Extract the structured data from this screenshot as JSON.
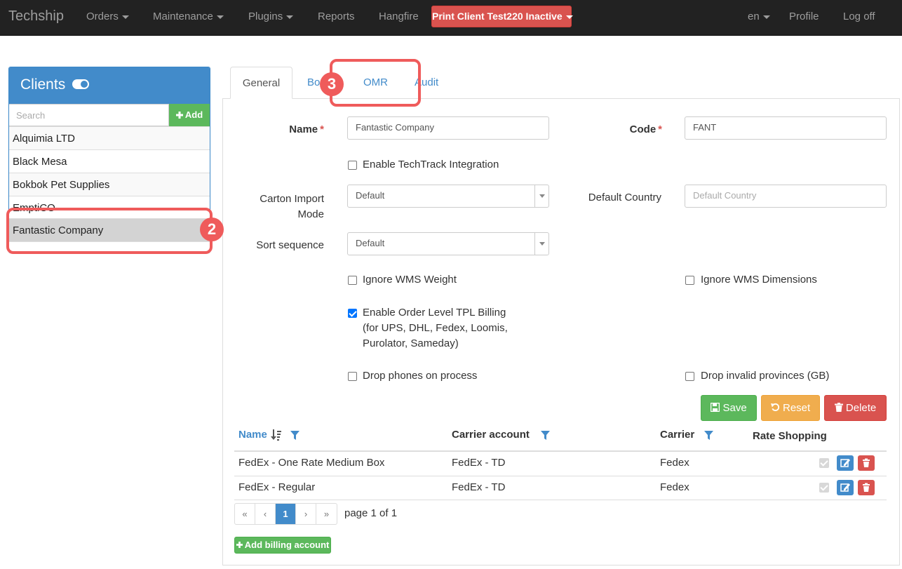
{
  "navbar": {
    "brand": "Techship",
    "items": [
      {
        "label": "Orders",
        "dropdown": true
      },
      {
        "label": "Maintenance",
        "dropdown": true
      },
      {
        "label": "Plugins",
        "dropdown": true
      },
      {
        "label": "Reports",
        "dropdown": false
      },
      {
        "label": "Hangfire",
        "dropdown": false
      }
    ],
    "print_client": "Print Client Test220 Inactive",
    "language": "en",
    "profile": "Profile",
    "logoff": "Log off"
  },
  "clients": {
    "title": "Clients",
    "search_placeholder": "Search",
    "add_label": "Add",
    "items": [
      "Alquimia LTD",
      "Black Mesa",
      "Bokbok Pet Supplies",
      "EmptiCO",
      "Fantastic Company"
    ],
    "selected": "Fantastic Company"
  },
  "tabs": [
    "General",
    "Bo",
    "OMR",
    "Audit"
  ],
  "active_tab": "General",
  "form": {
    "name_label": "Name",
    "name_value": "Fantastic Company",
    "code_label": "Code",
    "code_value": "FANT",
    "techtrack_label": "Enable TechTrack Integration",
    "carton_import_label_line1": "Carton Import",
    "carton_import_label_line2": "Mode",
    "carton_import_value": "Default",
    "default_country_label": "Default Country",
    "default_country_placeholder": "Default Country",
    "sort_sequence_label": "Sort sequence",
    "sort_sequence_value": "Default",
    "ignore_weight_label": "Ignore WMS Weight",
    "ignore_dimensions_label": "Ignore WMS Dimensions",
    "tpl_billing_line1": "Enable Order Level TPL Billing",
    "tpl_billing_line2": "(for UPS, DHL, Fedex, Loomis,",
    "tpl_billing_line3": "Purolator, Sameday)",
    "drop_phones_label": "Drop phones on process",
    "drop_provinces_label": "Drop invalid provinces (GB)",
    "checkboxes": {
      "techtrack": false,
      "ignore_weight": false,
      "ignore_dimensions": false,
      "tpl_billing": true,
      "drop_phones": false,
      "drop_provinces": false
    }
  },
  "actions": {
    "save": "Save",
    "reset": "Reset",
    "delete": "Delete"
  },
  "grid": {
    "headers": [
      "Name",
      "Carrier account",
      "Carrier",
      "Rate Shopping"
    ],
    "rows": [
      {
        "name": "FedEx - One Rate Medium Box",
        "carrier_account": "FedEx - TD",
        "carrier": "Fedex",
        "rate_shopping": true
      },
      {
        "name": "FedEx - Regular",
        "carrier_account": "FedEx - TD",
        "carrier": "Fedex",
        "rate_shopping": true
      }
    ],
    "pager": {
      "first": "«",
      "prev": "‹",
      "current": "1",
      "next": "›",
      "last": "»",
      "info": "page 1 of 1"
    },
    "add_billing": "Add billing account"
  },
  "annotations": {
    "badge2": "2",
    "badge3": "3"
  },
  "colors": {
    "navbar": "#222222",
    "primary": "#428bca",
    "success": "#5cb85c",
    "warning": "#f0ad4e",
    "danger": "#d9534f",
    "annotation": "#ef5b5b"
  }
}
